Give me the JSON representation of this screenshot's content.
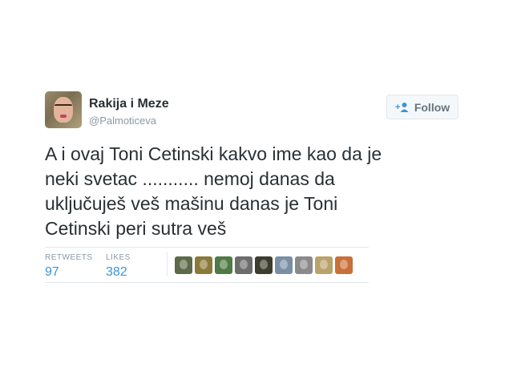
{
  "user": {
    "name": "Rakija i Meze",
    "handle": "@Palmoticeva"
  },
  "follow_button": {
    "label": "Follow",
    "icon": "add-user-icon"
  },
  "tweet": {
    "lines": [
      "A i ovaj Toni Cetinski kakvo ime kao da je",
      "neki svetac ........... nemoj danas da",
      "uključuješ veš mašinu danas je Toni",
      "Cetinski peri sutra veš"
    ]
  },
  "stats": {
    "retweets_label": "RETWEETS",
    "retweets_value": "97",
    "likes_label": "LIKES",
    "likes_value": "382"
  },
  "likers": [
    {
      "color": "#5b6b4a"
    },
    {
      "color": "#8a7a3a"
    },
    {
      "color": "#4f7a44"
    },
    {
      "color": "#6c6c6c"
    },
    {
      "color": "#3d3d2e"
    },
    {
      "color": "#7a8fa6"
    },
    {
      "color": "#8a8a8a"
    },
    {
      "color": "#b9a36a"
    },
    {
      "color": "#c9703a"
    }
  ],
  "colors": {
    "link_blue": "#3b94d9",
    "muted": "#8899a6",
    "text": "#292f33"
  }
}
